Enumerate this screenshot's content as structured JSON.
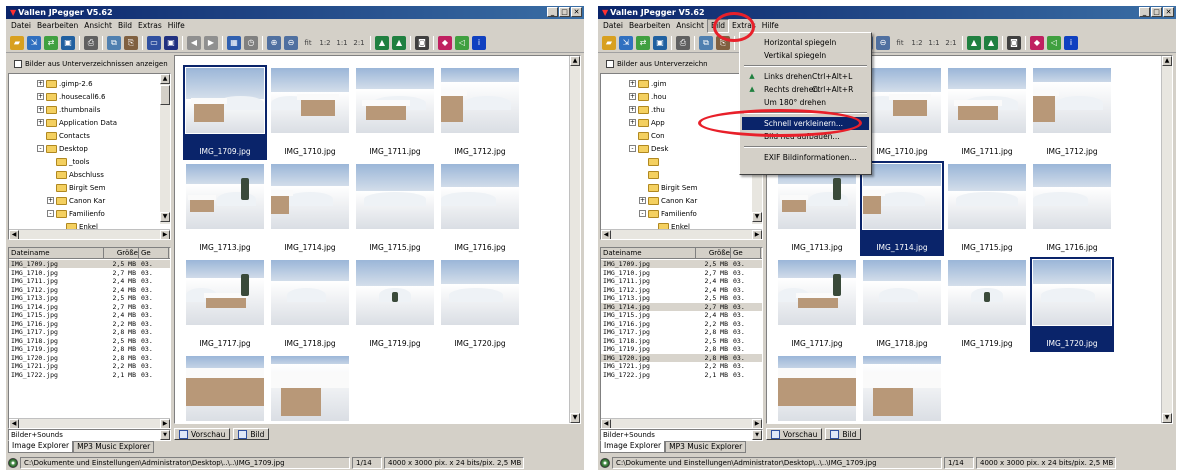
{
  "app": {
    "title": "Vallen JPegger V5.62",
    "title_right_cut": "Vallen JPegger V5.62",
    "window_buttons": [
      "_",
      "□",
      "✕"
    ]
  },
  "menu": [
    "Datei",
    "Bearbeiten",
    "Ansicht",
    "Bild",
    "Extras",
    "Hilfe"
  ],
  "menu_right": [
    "Datei",
    "Bearbeiten",
    "Ansicht",
    "Bild",
    "Extras",
    "Hilfe"
  ],
  "toolbar": {
    "icons": [
      "open-folder-icon",
      "browse-icon",
      "share-icon",
      "slideshow-icon",
      "print-icon",
      "copy-icon",
      "paste-icon",
      "screen-icon",
      "fullscreen-icon",
      "prev-icon",
      "next-icon",
      "thumbnails-icon",
      "timer-icon",
      "zoom-in-icon",
      "zoom-out-icon",
      "fit-icon",
      "zoom-12-icon",
      "zoom-11-icon",
      "zoom-21-icon",
      "rotate-left-icon",
      "rotate-right-icon",
      "camera-icon",
      "effects-icon",
      "sound-icon",
      "info-icon"
    ],
    "zoom_labels": [
      "fit",
      "1:2",
      "1:1",
      "2:1"
    ]
  },
  "include_subfolders_label": "Bilder aus Unterverzeichnissen anzeigen",
  "include_subfolders_label_right": "Bilder aus Unterverzeichn",
  "tree": [
    {
      "label": ".gimp-2.6",
      "depth": 3,
      "expander": "+"
    },
    {
      "label": ".housecall6.6",
      "depth": 3,
      "expander": "+"
    },
    {
      "label": ".thumbnails",
      "depth": 3,
      "expander": "+"
    },
    {
      "label": "Application Data",
      "depth": 3,
      "expander": "+"
    },
    {
      "label": "Contacts",
      "depth": 3,
      "expander": ""
    },
    {
      "label": "Desktop",
      "depth": 3,
      "expander": "-"
    },
    {
      "label": "_tools",
      "depth": 4,
      "expander": ""
    },
    {
      "label": "Abschluss",
      "depth": 4,
      "expander": ""
    },
    {
      "label": "Birgit Sem",
      "depth": 4,
      "expander": ""
    },
    {
      "label": "Canon Kar",
      "depth": 4,
      "expander": "+"
    },
    {
      "label": "Familienfo",
      "depth": 4,
      "expander": "-"
    },
    {
      "label": "Enkel",
      "depth": 5,
      "expander": ""
    }
  ],
  "tree_right": [
    {
      "label": ".gim",
      "depth": 3,
      "expander": "+"
    },
    {
      "label": ".hou",
      "depth": 3,
      "expander": "+"
    },
    {
      "label": ".thu",
      "depth": 3,
      "expander": "+"
    },
    {
      "label": "App",
      "depth": 3,
      "expander": "+"
    },
    {
      "label": "Con",
      "depth": 3,
      "expander": ""
    },
    {
      "label": "Desk",
      "depth": 3,
      "expander": "-"
    },
    {
      "label": "",
      "depth": 4,
      "expander": ""
    },
    {
      "label": "",
      "depth": 4,
      "expander": ""
    },
    {
      "label": "Birgit Sem",
      "depth": 4,
      "expander": ""
    },
    {
      "label": "Canon Kar",
      "depth": 4,
      "expander": "+"
    },
    {
      "label": "Familienfo",
      "depth": 4,
      "expander": "-"
    },
    {
      "label": "Enkel",
      "depth": 5,
      "expander": ""
    }
  ],
  "file_list": {
    "columns": [
      "Dateiname",
      "Größe",
      "Ge"
    ],
    "rows": [
      {
        "name": "IMG_1709.jpg",
        "size": "2,5 MB",
        "date": "03."
      },
      {
        "name": "IMG_1710.jpg",
        "size": "2,7 MB",
        "date": "03."
      },
      {
        "name": "IMG_1711.jpg",
        "size": "2,4 MB",
        "date": "03."
      },
      {
        "name": "IMG_1712.jpg",
        "size": "2,4 MB",
        "date": "03."
      },
      {
        "name": "IMG_1713.jpg",
        "size": "2,5 MB",
        "date": "03."
      },
      {
        "name": "IMG_1714.jpg",
        "size": "2,7 MB",
        "date": "03."
      },
      {
        "name": "IMG_1715.jpg",
        "size": "2,4 MB",
        "date": "03."
      },
      {
        "name": "IMG_1716.jpg",
        "size": "2,2 MB",
        "date": "03."
      },
      {
        "name": "IMG_1717.jpg",
        "size": "2,8 MB",
        "date": "03."
      },
      {
        "name": "IMG_1718.jpg",
        "size": "2,5 MB",
        "date": "03."
      },
      {
        "name": "IMG_1719.jpg",
        "size": "2,8 MB",
        "date": "03."
      },
      {
        "name": "IMG_1720.jpg",
        "size": "2,8 MB",
        "date": "03."
      },
      {
        "name": "IMG_1721.jpg",
        "size": "2,2 MB",
        "date": "03."
      },
      {
        "name": "IMG_1722.jpg",
        "size": "2,1 MB",
        "date": "03."
      }
    ],
    "selected_left": [
      0
    ],
    "selected_right": [
      0,
      5,
      11
    ]
  },
  "filter": "Bilder+Sounds",
  "thumbnails": [
    {
      "caption": "IMG_1709.jpg"
    },
    {
      "caption": "IMG_1710.jpg"
    },
    {
      "caption": "IMG_1711.jpg"
    },
    {
      "caption": "IMG_1712.jpg"
    },
    {
      "caption": "IMG_1713.jpg"
    },
    {
      "caption": "IMG_1714.jpg"
    },
    {
      "caption": "IMG_1715.jpg"
    },
    {
      "caption": "IMG_1716.jpg"
    },
    {
      "caption": "IMG_1717.jpg"
    },
    {
      "caption": "IMG_1718.jpg"
    },
    {
      "caption": "IMG_1719.jpg"
    },
    {
      "caption": "IMG_1720.jpg"
    },
    {
      "caption": ""
    },
    {
      "caption": ""
    }
  ],
  "selected_thumbs_left": [
    0
  ],
  "selected_thumbs_right": [
    5,
    11
  ],
  "view_tabs": [
    "Vorschau",
    "Bild"
  ],
  "bottom_tabs": [
    "Image Explorer",
    "MP3 Music Explorer"
  ],
  "status": {
    "path": "C:\\Dokumente und Einstellungen\\Administrator\\Desktop\\..\\..\\IMG_1709.jpg",
    "position": "1/14",
    "info": "4000 x 3000 pix. x 24 bits/pix. 2,5 MB"
  },
  "bild_menu": {
    "items": [
      {
        "label": "Horizontal spiegeln",
        "shortcut": "",
        "icon": ""
      },
      {
        "label": "Vertikal spiegeln",
        "shortcut": "",
        "icon": ""
      },
      {
        "sep": true
      },
      {
        "label": "Links drehen",
        "shortcut": "Ctrl+Alt+L",
        "icon": "rotate-left-icon"
      },
      {
        "label": "Rechts drehen",
        "shortcut": "Ctrl+Alt+R",
        "icon": "rotate-right-icon"
      },
      {
        "label": "Um 180° drehen",
        "shortcut": "",
        "icon": ""
      },
      {
        "sep": true
      },
      {
        "label": "Schnell verkleinern...",
        "shortcut": "",
        "icon": "",
        "highlighted": true
      },
      {
        "label": "Bild neu aufbauen...",
        "shortcut": "",
        "icon": ""
      },
      {
        "sep": true
      },
      {
        "label": "EXIF Bildinformationen...",
        "shortcut": "",
        "icon": ""
      }
    ]
  },
  "colors": {
    "titlebar": "#0a246a",
    "selection": "#0a246a",
    "annotation": "#e8202a",
    "chrome": "#d4d0c8"
  }
}
